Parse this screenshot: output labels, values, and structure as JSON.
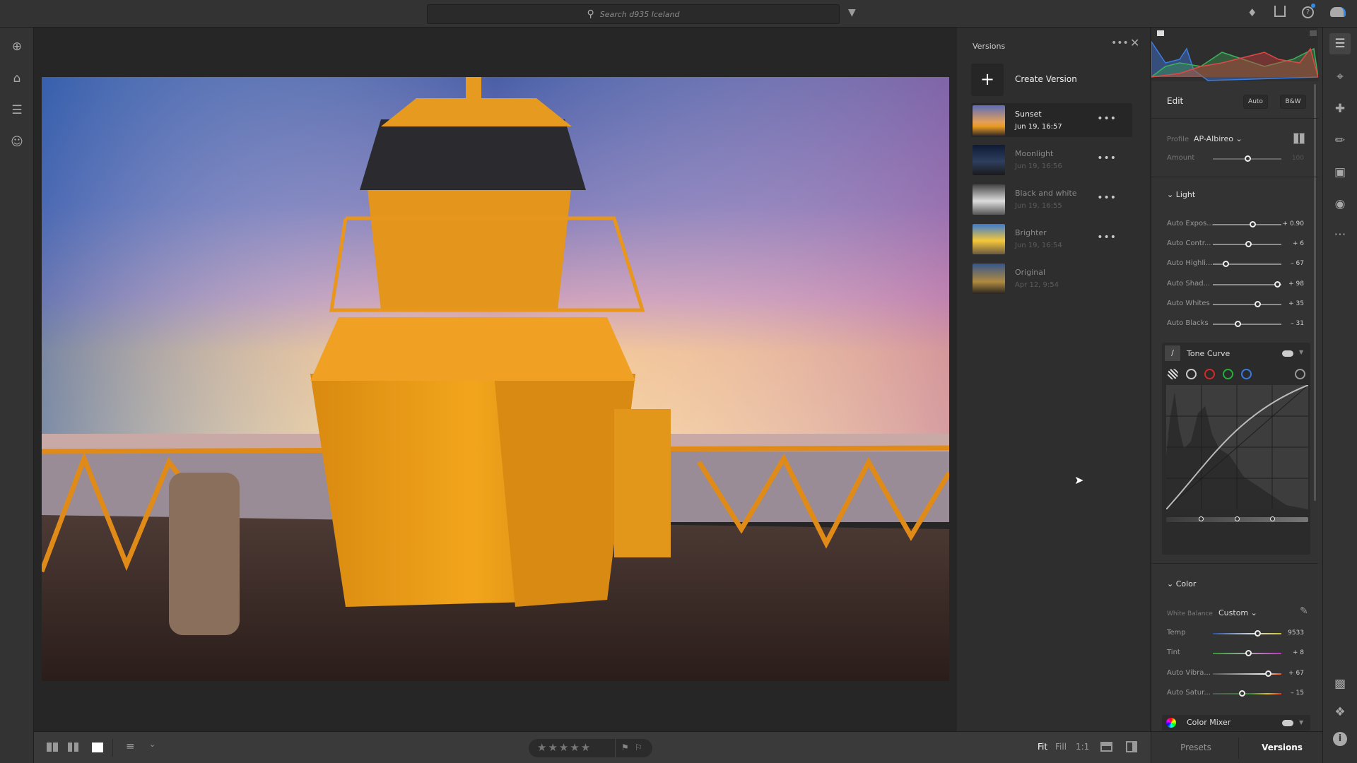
{
  "topbar": {
    "search_placeholder": "Search d935 Iceland",
    "icons": [
      "search-icon",
      "filter-icon",
      "bell-icon",
      "share-icon",
      "help-icon",
      "cloud-sync-icon"
    ]
  },
  "left_rail": {
    "icons": [
      "add-photos-icon",
      "home-icon",
      "library-icon",
      "people-icon"
    ]
  },
  "versions_panel": {
    "title": "Versions",
    "create_label": "Create Version",
    "items": [
      {
        "name": "Sunset",
        "date": "Jun 19, 16:57",
        "selected": true
      },
      {
        "name": "Moonlight",
        "date": "Jun 19, 16:56"
      },
      {
        "name": "Black and white",
        "date": "Jun 19, 16:55"
      },
      {
        "name": "Brighter",
        "date": "Jun 19, 16:54"
      },
      {
        "name": "Original",
        "date": "Apr 12, 9:54"
      }
    ]
  },
  "edit": {
    "title": "Edit",
    "auto_label": "Auto",
    "bw_label": "B&W",
    "profile_label": "Profile",
    "profile_value": "AP-Albireo",
    "amount_label": "Amount",
    "amount_value": "100",
    "amount_pos": 0.5,
    "light": {
      "title": "Light",
      "sliders": [
        {
          "label": "Auto Expos...",
          "value": "+ 0.90",
          "pos": 0.58
        },
        {
          "label": "Auto Contr...",
          "value": "+ 6",
          "pos": 0.52
        },
        {
          "label": "Auto Highli...",
          "value": "– 67",
          "pos": 0.19
        },
        {
          "label": "Auto Shad...",
          "value": "+ 98",
          "pos": 0.94
        },
        {
          "label": "Auto Whites",
          "value": "+ 35",
          "pos": 0.65
        },
        {
          "label": "Auto Blacks",
          "value": "– 31",
          "pos": 0.36
        }
      ]
    },
    "tone_curve": {
      "title": "Tone Curve"
    },
    "color": {
      "title": "Color",
      "wb_label": "White Balance",
      "wb_value": "Custom",
      "sliders": [
        {
          "label": "Temp",
          "value": "9533",
          "pos": 0.65
        },
        {
          "label": "Tint",
          "value": "+ 8",
          "pos": 0.52
        },
        {
          "label": "Auto Vibra...",
          "value": "+ 67",
          "pos": 0.8
        },
        {
          "label": "Auto Satur...",
          "value": "– 15",
          "pos": 0.42
        }
      ]
    },
    "color_mixer": {
      "title": "Color Mixer"
    }
  },
  "bottom": {
    "fit": "Fit",
    "fill": "Fill",
    "one_to_one": "1:1",
    "stars": "★★★★★",
    "presets_tab": "Presets",
    "versions_tab": "Versions"
  }
}
